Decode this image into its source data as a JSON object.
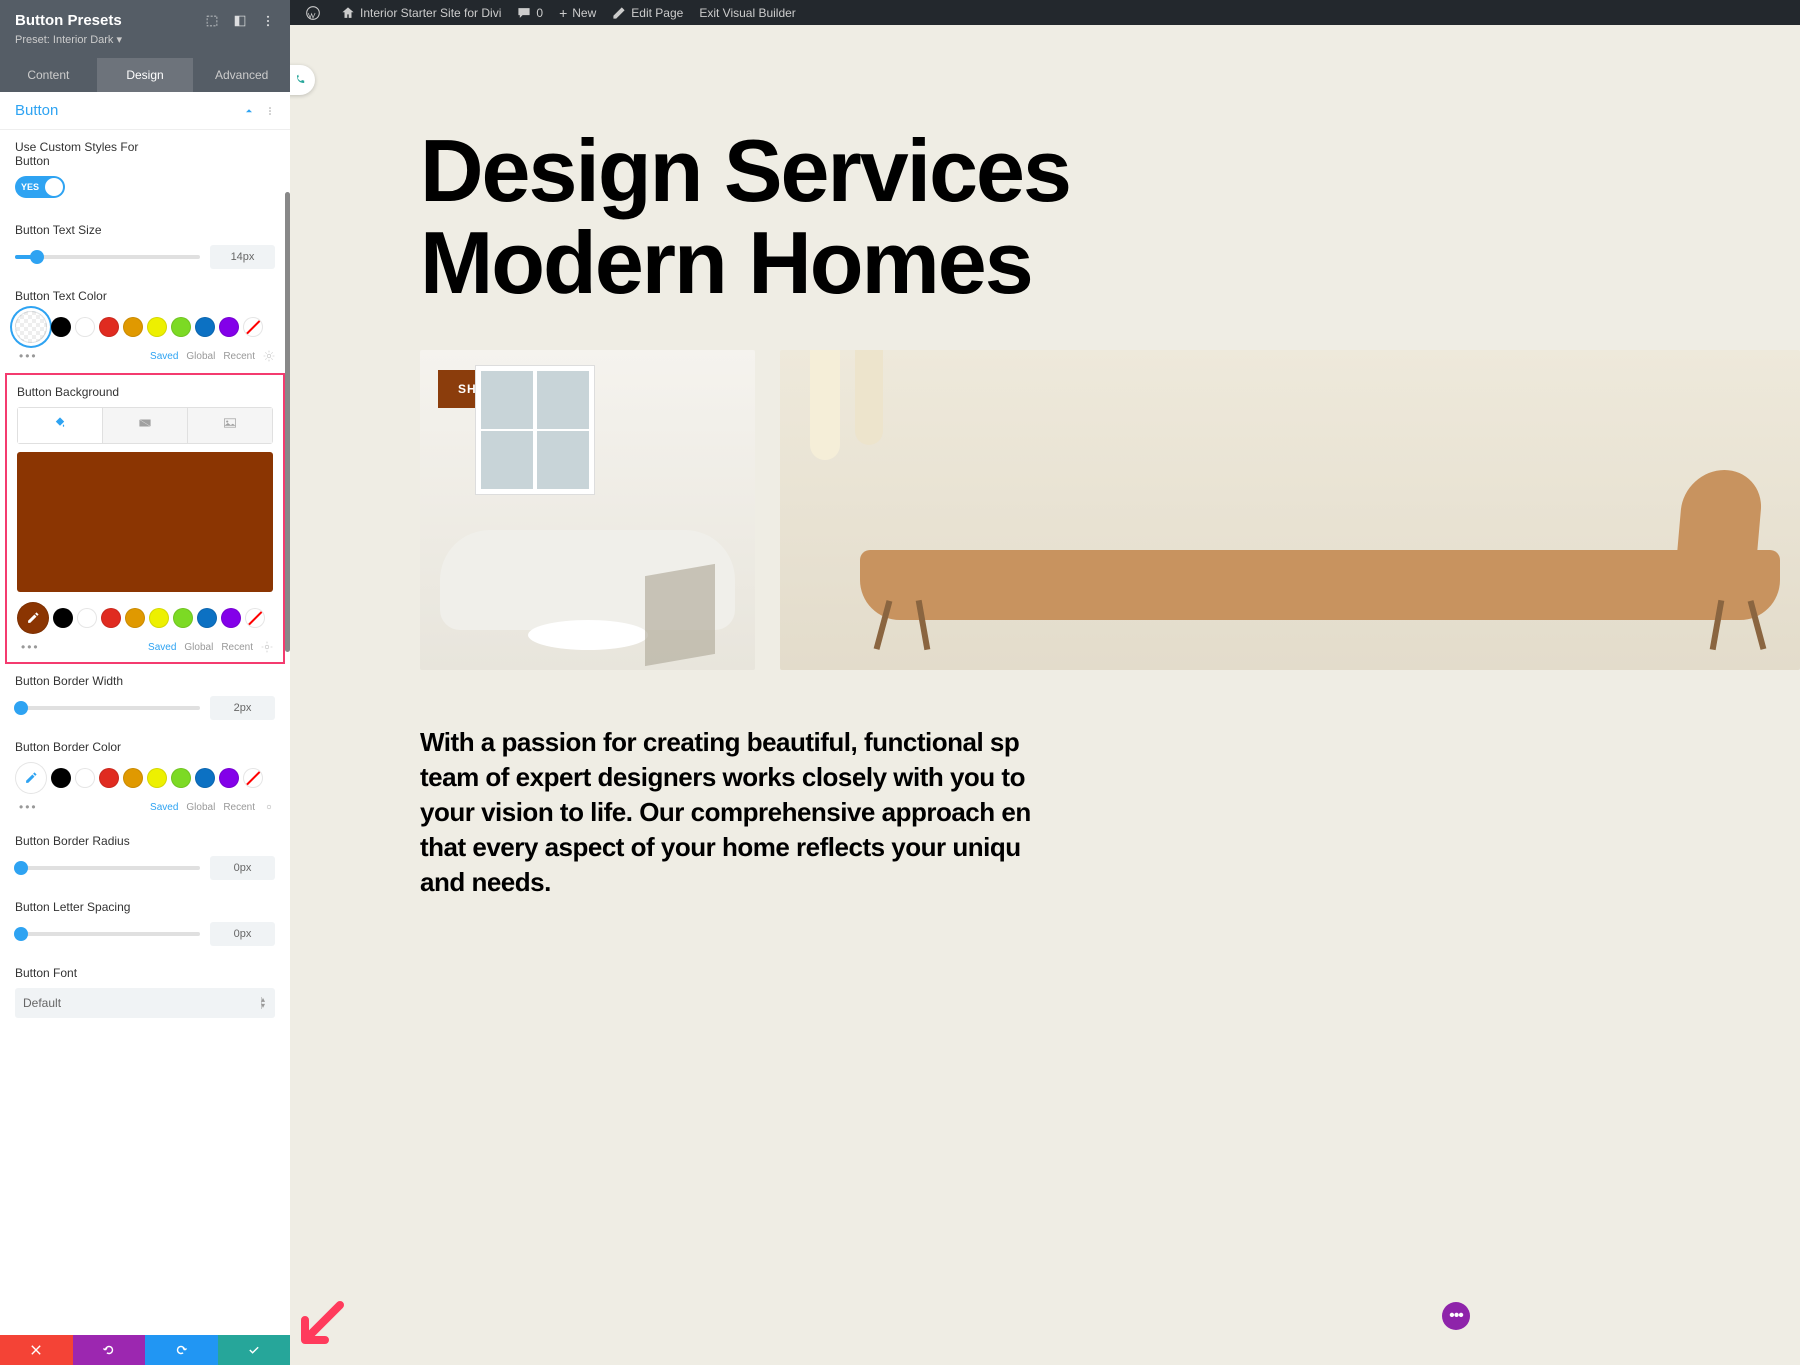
{
  "admin_bar": {
    "site_name": "Interior Starter Site for Divi",
    "comments": "0",
    "new": "New",
    "edit_page": "Edit Page",
    "exit_vb": "Exit Visual Builder"
  },
  "sidebar": {
    "title": "Button Presets",
    "subtitle_prefix": "Preset: ",
    "subtitle_value": "Interior Dark",
    "tabs": {
      "content": "Content",
      "design": "Design",
      "advanced": "Advanced"
    },
    "section": "Button",
    "use_custom": "Use Custom Styles For Button",
    "toggle_yes": "YES",
    "text_size_label": "Button Text Size",
    "text_size_value": "14px",
    "text_color_label": "Button Text Color",
    "palette_meta": {
      "saved": "Saved",
      "global": "Global",
      "recent": "Recent"
    },
    "bg_label": "Button Background",
    "bg_color": "#8b3502",
    "border_width_label": "Button Border Width",
    "border_width_value": "2px",
    "border_color_label": "Button Border Color",
    "border_radius_label": "Button Border Radius",
    "border_radius_value": "0px",
    "letter_spacing_label": "Button Letter Spacing",
    "letter_spacing_value": "0px",
    "font_label": "Button Font",
    "font_value": "Default"
  },
  "palette_colors": [
    "#000000",
    "#ffffff",
    "#e02b20",
    "#e09900",
    "#edf000",
    "#7cda24",
    "#0c71c3",
    "#8300e9"
  ],
  "preview": {
    "hero_line1": "Design Services",
    "hero_line2": "Modern Homes",
    "shop_btn": "SHOP ONLINE",
    "body_text": "With a passion for creating beautiful, functional sp\nteam of expert designers works closely with you to\nyour vision to life. Our comprehensive approach en\nthat every aspect of your home reflects your uniqu\nand needs."
  }
}
